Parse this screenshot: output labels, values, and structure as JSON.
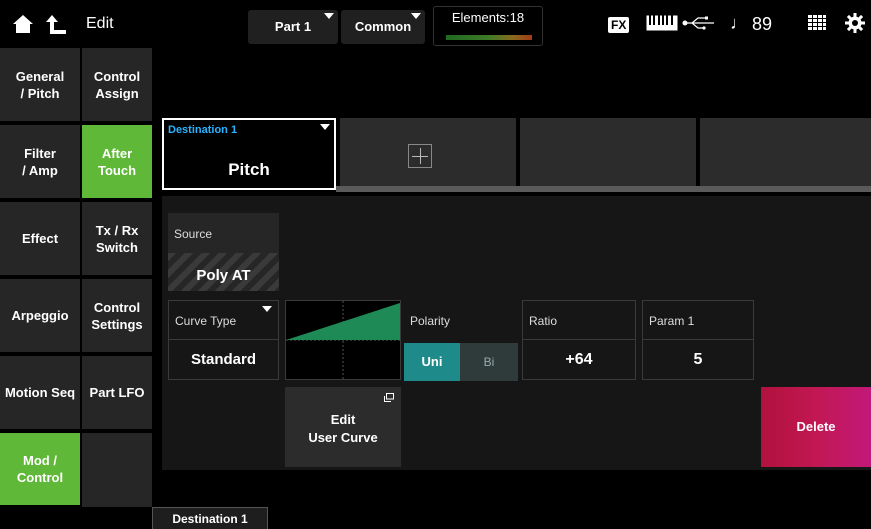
{
  "header": {
    "edit_label": "Edit",
    "part_label": "Part 1",
    "common_label": "Common",
    "elements_label": "Elements:18",
    "fx_label": "FX",
    "tempo_note": "♩",
    "tempo": "89"
  },
  "nav_primary": [
    {
      "label": "General\n/ Pitch",
      "active": false
    },
    {
      "label": "Filter\n/ Amp",
      "active": false
    },
    {
      "label": "Effect",
      "active": false
    },
    {
      "label": "Arpeggio",
      "active": false
    },
    {
      "label": "Motion Seq",
      "active": false
    },
    {
      "label": "Mod /\nControl",
      "active": true
    }
  ],
  "nav_secondary": [
    {
      "label": "Control\nAssign",
      "active": false
    },
    {
      "label": "After\nTouch",
      "active": true
    },
    {
      "label": "Tx / Rx\nSwitch",
      "active": false
    },
    {
      "label": "Control\nSettings",
      "active": false
    },
    {
      "label": "Part LFO",
      "active": false
    }
  ],
  "destination": {
    "label": "Destination 1",
    "value": "Pitch"
  },
  "source": {
    "label": "Source",
    "value": "Poly AT"
  },
  "curve_type": {
    "label": "Curve Type",
    "value": "Standard"
  },
  "polarity": {
    "label": "Polarity",
    "options": [
      "Uni",
      "Bi"
    ],
    "selected": "Uni"
  },
  "ratio": {
    "label": "Ratio",
    "value": "+64"
  },
  "param1": {
    "label": "Param 1",
    "value": "5"
  },
  "edit_user_curve": {
    "line1": "Edit",
    "line2": "User Curve"
  },
  "delete_label": "Delete",
  "bottom_tab": "Destination 1",
  "colors": {
    "active_green": "#5fb838",
    "accent_blue": "#2ab4ff",
    "polarity_teal": "#1f8a8a",
    "delete_red": "#c21753",
    "curve_green": "#1e8a55"
  }
}
